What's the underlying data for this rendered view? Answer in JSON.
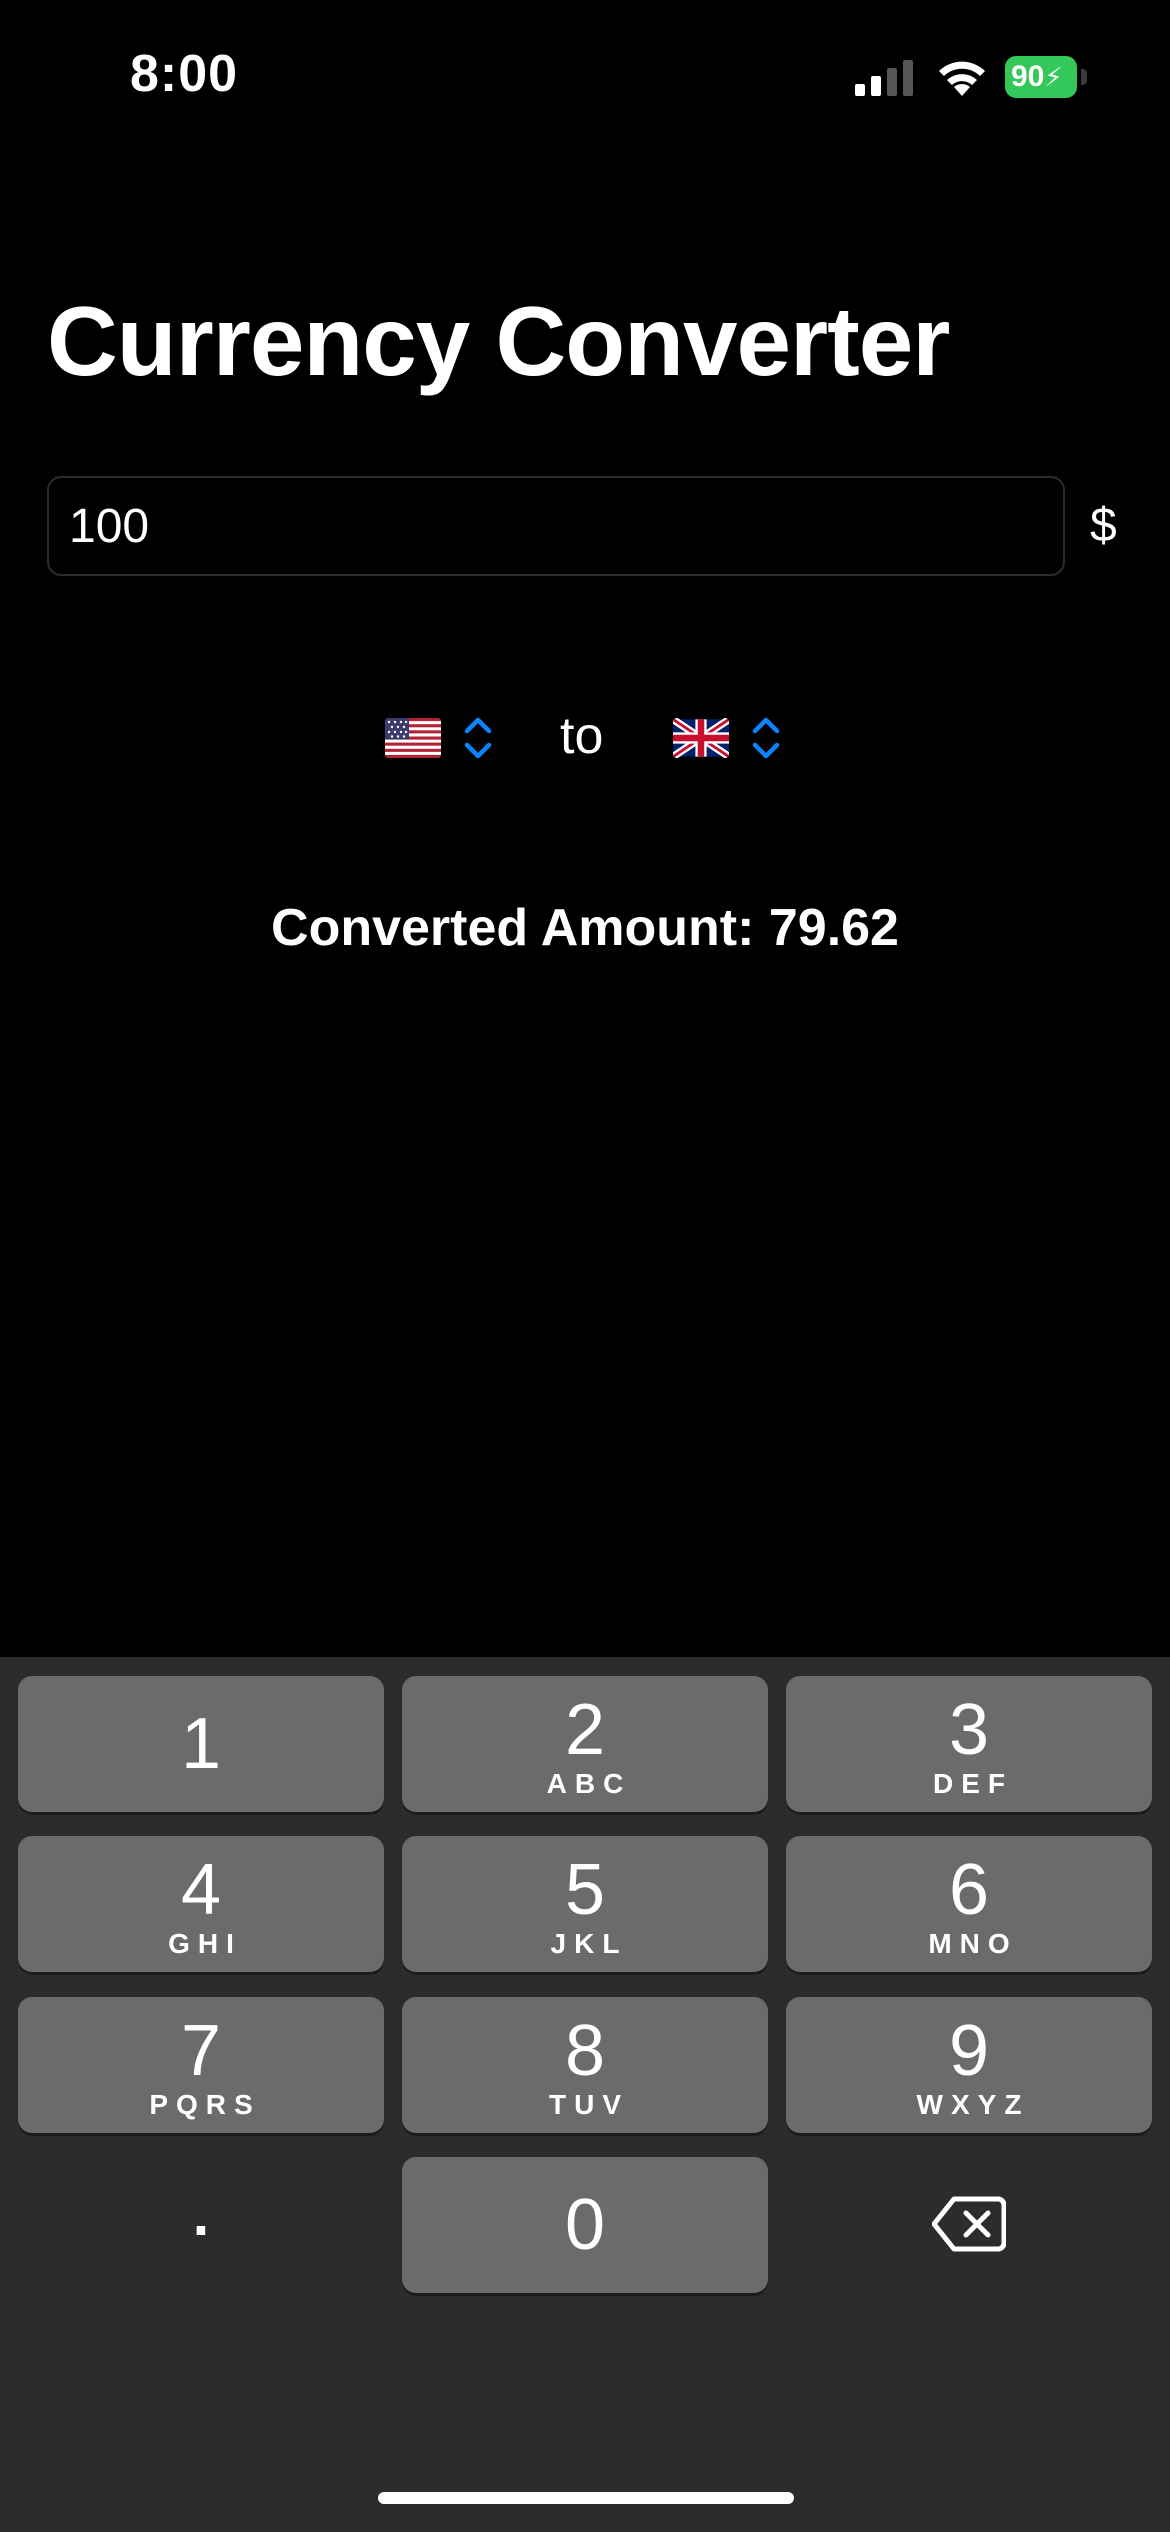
{
  "status": {
    "time": "8:00",
    "battery": "90"
  },
  "title": "Currency Converter",
  "amount_field": {
    "value": "100",
    "currency_symbol": "$"
  },
  "pickers": {
    "from_flag": "us-flag-icon",
    "to_label": "to",
    "to_flag": "uk-flag-icon"
  },
  "result": {
    "text": "Converted Amount: 79.62"
  },
  "keypad": {
    "keys": [
      {
        "digit": "1",
        "letters": ""
      },
      {
        "digit": "2",
        "letters": "ABC"
      },
      {
        "digit": "3",
        "letters": "DEF"
      },
      {
        "digit": "4",
        "letters": "GHI"
      },
      {
        "digit": "5",
        "letters": "JKL"
      },
      {
        "digit": "6",
        "letters": "MNO"
      },
      {
        "digit": "7",
        "letters": "PQRS"
      },
      {
        "digit": "8",
        "letters": "TUV"
      },
      {
        "digit": "9",
        "letters": "WXYZ"
      },
      {
        "digit": ".",
        "letters": ""
      },
      {
        "digit": "0",
        "letters": ""
      }
    ],
    "delete_icon": "delete-backspace-icon"
  },
  "colors": {
    "background": "#000000",
    "accent": "#0a84ff",
    "battery": "#34c759",
    "keyboard": "#2c2c2e",
    "key": "#6b6b6b"
  }
}
